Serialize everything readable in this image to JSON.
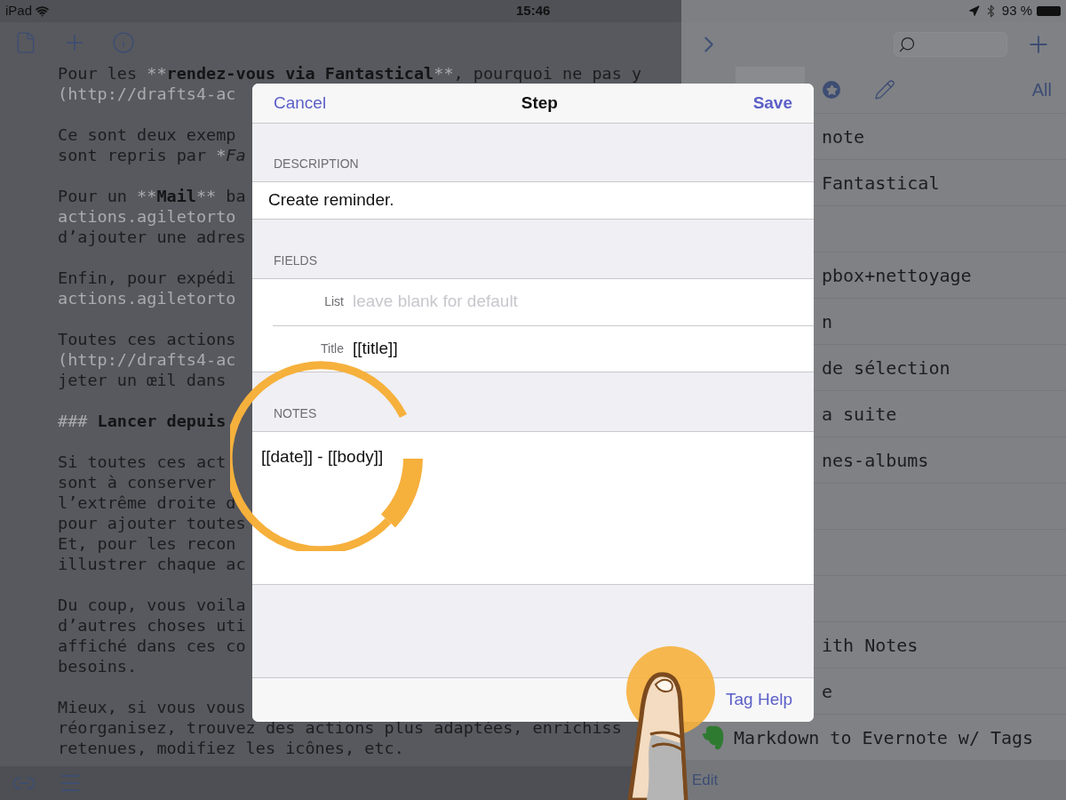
{
  "status_bar": {
    "device": "iPad",
    "time": "15:46",
    "battery": "93 %"
  },
  "editor": {
    "lines": [
      {
        "kind": "text",
        "segments": [
          {
            "t": "Pour les ",
            "kind": "plain"
          },
          {
            "t": "**",
            "kind": "faded"
          },
          {
            "t": "rendez-vous via Fantastical",
            "kind": "bold"
          },
          {
            "t": "**",
            "kind": "faded"
          },
          {
            "t": ", pourquoi ne pas y",
            "kind": "plain"
          }
        ]
      },
      {
        "kind": "text",
        "segments": [
          {
            "t": "(http://drafts4-ac",
            "kind": "faded"
          }
        ]
      },
      {
        "kind": "blank"
      },
      {
        "kind": "text",
        "segments": [
          {
            "t": "Ce sont deux exemp",
            "kind": "plain"
          }
        ]
      },
      {
        "kind": "text",
        "segments": [
          {
            "t": "sont repris par ",
            "kind": "plain"
          },
          {
            "t": "*",
            "kind": "faded"
          },
          {
            "t": "Fa",
            "kind": "italic"
          }
        ]
      },
      {
        "kind": "blank"
      },
      {
        "kind": "text",
        "segments": [
          {
            "t": "Pour un ",
            "kind": "plain"
          },
          {
            "t": "**",
            "kind": "faded"
          },
          {
            "t": "Mail",
            "kind": "bold"
          },
          {
            "t": "**",
            "kind": "faded"
          },
          {
            "t": " ba",
            "kind": "plain"
          }
        ]
      },
      {
        "kind": "text",
        "segments": [
          {
            "t": "actions.agiletorto",
            "kind": "faded"
          }
        ]
      },
      {
        "kind": "text",
        "segments": [
          {
            "t": "d’ajouter une adres",
            "kind": "plain"
          }
        ]
      },
      {
        "kind": "blank"
      },
      {
        "kind": "text",
        "segments": [
          {
            "t": "Enfin, pour expédi",
            "kind": "plain"
          }
        ]
      },
      {
        "kind": "text",
        "segments": [
          {
            "t": "actions.agiletorto",
            "kind": "faded"
          }
        ]
      },
      {
        "kind": "blank"
      },
      {
        "kind": "text",
        "segments": [
          {
            "t": "Toutes ces actions",
            "kind": "plain"
          }
        ]
      },
      {
        "kind": "text",
        "segments": [
          {
            "t": "(http://drafts4-ac",
            "kind": "faded"
          }
        ]
      },
      {
        "kind": "text",
        "segments": [
          {
            "t": "jeter un œil dans",
            "kind": "plain"
          }
        ]
      },
      {
        "kind": "blank"
      },
      {
        "kind": "text",
        "segments": [
          {
            "t": "###",
            "kind": "faded"
          },
          {
            "t": " Lancer depuis",
            "kind": "bold"
          }
        ]
      },
      {
        "kind": "blank"
      },
      {
        "kind": "text",
        "segments": [
          {
            "t": "Si toutes ces act",
            "kind": "plain"
          }
        ]
      },
      {
        "kind": "text",
        "segments": [
          {
            "t": "sont à conserver",
            "kind": "plain"
          }
        ]
      },
      {
        "kind": "text",
        "segments": [
          {
            "t": "l’extrême droite d",
            "kind": "plain"
          }
        ]
      },
      {
        "kind": "text",
        "segments": [
          {
            "t": "pour ajouter toutes",
            "kind": "plain"
          }
        ]
      },
      {
        "kind": "text",
        "segments": [
          {
            "t": "Et, pour les recon",
            "kind": "plain"
          }
        ]
      },
      {
        "kind": "text",
        "segments": [
          {
            "t": "illustrer chaque ac",
            "kind": "plain"
          }
        ]
      },
      {
        "kind": "blank"
      },
      {
        "kind": "text",
        "segments": [
          {
            "t": "Du coup, vous voila",
            "kind": "plain"
          }
        ]
      },
      {
        "kind": "text",
        "segments": [
          {
            "t": "d’autres choses uti",
            "kind": "plain"
          }
        ]
      },
      {
        "kind": "text",
        "segments": [
          {
            "t": "affiché dans ces co",
            "kind": "plain"
          }
        ]
      },
      {
        "kind": "text",
        "segments": [
          {
            "t": "besoins.",
            "kind": "plain"
          }
        ]
      },
      {
        "kind": "blank"
      },
      {
        "kind": "text",
        "segments": [
          {
            "t": "Mieux, si vous vous",
            "kind": "plain"
          }
        ]
      },
      {
        "kind": "text",
        "segments": [
          {
            "t": "réorganisez, trouvez des actions plus adaptées, enrichiss",
            "kind": "plain"
          }
        ]
      },
      {
        "kind": "text",
        "segments": [
          {
            "t": "retenues, modifiez les icônes, etc.",
            "kind": "plain"
          }
        ]
      }
    ]
  },
  "sidebar": {
    "all_label": "All",
    "rows": [
      {
        "kind": "plain",
        "label": "note"
      },
      {
        "kind": "plain",
        "label": "Fantastical"
      },
      {
        "kind": "blank"
      },
      {
        "kind": "plain",
        "label": "pbox+nettoyage"
      },
      {
        "kind": "plain",
        "label": "n"
      },
      {
        "kind": "plain",
        "label": "de sélection"
      },
      {
        "kind": "plain",
        "label": "a suite"
      },
      {
        "kind": "plain",
        "label": "nes-albums"
      },
      {
        "kind": "blank"
      },
      {
        "kind": "blank"
      },
      {
        "kind": "blank"
      },
      {
        "kind": "plain",
        "label": "ith Notes"
      },
      {
        "kind": "plain",
        "label": "e"
      },
      {
        "kind": "evernote",
        "label": "Markdown to Evernote w/ Tags"
      }
    ],
    "edit": "Edit"
  },
  "modal": {
    "title": "Step",
    "cancel": "Cancel",
    "save": "Save",
    "description": {
      "header": "DESCRIPTION",
      "value": "Create reminder."
    },
    "fields": {
      "header": "FIELDS",
      "rows": [
        {
          "label": "List",
          "placeholder": "leave blank for default"
        },
        {
          "label": "Title",
          "value": "[[title]]"
        }
      ]
    },
    "notes": {
      "header": "NOTES",
      "value": "[[date]] - [[body]]"
    },
    "tag_help": "Tag Help"
  }
}
